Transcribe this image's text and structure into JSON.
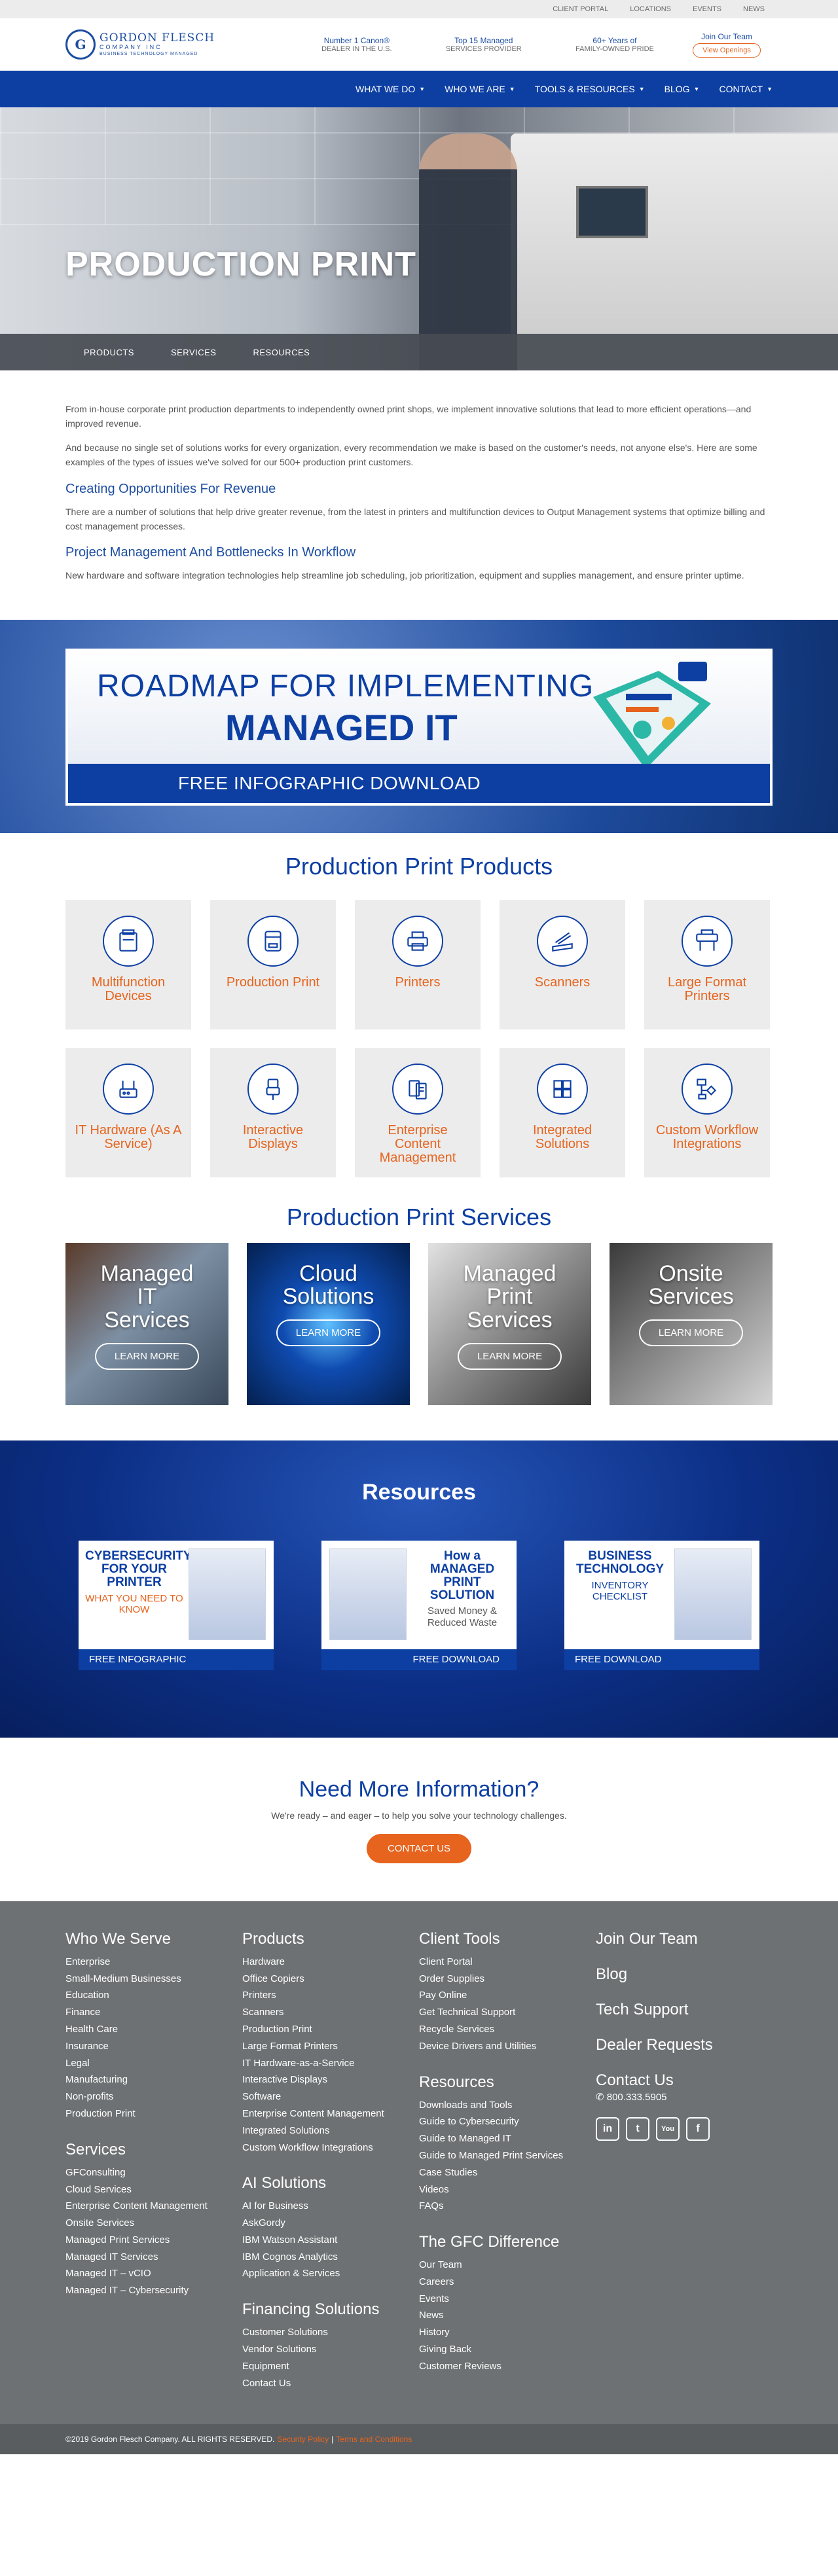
{
  "utility": {
    "links": [
      "CLIENT PORTAL",
      "LOCATIONS",
      "EVENTS",
      "NEWS"
    ]
  },
  "header": {
    "logo_name": "GORDON FLESCH",
    "logo_company": "COMPANY INC",
    "logo_tag": "BUSINESS TECHNOLOGY MANAGED",
    "stats": [
      {
        "top": "Number 1 Canon®",
        "bottom": "DEALER IN THE U.S."
      },
      {
        "top": "Top 15 Managed",
        "bottom": "SERVICES PROVIDER"
      },
      {
        "top": "60+ Years of",
        "bottom": "FAMILY-OWNED PRIDE"
      }
    ],
    "join_label": "Join Our Team",
    "join_button": "View Openings"
  },
  "nav": {
    "items": [
      "WHAT WE DO",
      "WHO WE ARE",
      "TOOLS & RESOURCES",
      "BLOG",
      "CONTACT"
    ]
  },
  "hero": {
    "title": "PRODUCTION PRINT",
    "subnav": [
      "PRODUCTS",
      "SERVICES",
      "RESOURCES"
    ]
  },
  "intro": {
    "p1": "From in-house corporate print production departments to independently owned print shops, we implement innovative solutions that lead to more efficient operations—and improved revenue.",
    "p2": "And because no single set of solutions works for every organization, every recommendation we make is based on the customer's needs, not anyone else's. Here are some examples of the types of issues we've solved for our 500+ production print customers.",
    "h1": "Creating Opportunities For Revenue",
    "p3": "There are a number of solutions that help drive greater revenue, from the latest in printers and multifunction devices to Output Management systems that optimize billing and cost management processes.",
    "h2": "Project Management And Bottlenecks In Workflow",
    "p4": "New hardware and software integration technologies help streamline job scheduling, job prioritization, equipment and supplies management, and ensure printer uptime."
  },
  "banner": {
    "line1": "ROADMAP FOR IMPLEMENTING",
    "line2": "MANAGED IT",
    "cta": "FREE INFOGRAPHIC DOWNLOAD"
  },
  "products": {
    "title": "Production Print Products",
    "items": [
      {
        "label": "Multifunction Devices",
        "icon": "mfp-icon"
      },
      {
        "label": "Production Print",
        "icon": "production-printer-icon"
      },
      {
        "label": "Printers",
        "icon": "printer-icon"
      },
      {
        "label": "Scanners",
        "icon": "scanner-icon"
      },
      {
        "label": "Large Format Printers",
        "icon": "large-format-printer-icon"
      },
      {
        "label": "IT Hardware (As A Service)",
        "icon": "router-icon"
      },
      {
        "label": "Interactive Displays",
        "icon": "usb-icon"
      },
      {
        "label": "Enterprise Content Management",
        "icon": "documents-icon"
      },
      {
        "label": "Integrated Solutions",
        "icon": "puzzle-icon"
      },
      {
        "label": "Custom Workflow Integrations",
        "icon": "workflow-icon"
      }
    ]
  },
  "services": {
    "title": "Production Print Services",
    "items": [
      {
        "title": "Managed IT Services",
        "button": "LEARN MORE"
      },
      {
        "title": "Cloud Solutions",
        "button": "LEARN MORE"
      },
      {
        "title": "Managed Print Services",
        "button": "LEARN MORE"
      },
      {
        "title": "Onsite Services",
        "button": "LEARN MORE"
      }
    ]
  },
  "resources": {
    "title": "Resources",
    "items": [
      {
        "big": "CYBERSECURITY FOR YOUR PRINTER",
        "small": "WHAT YOU NEED TO KNOW",
        "foot": "FREE INFOGRAPHIC"
      },
      {
        "big": "How a MANAGED PRINT SOLUTION",
        "small": "Saved Money & Reduced Waste",
        "foot": "FREE DOWNLOAD"
      },
      {
        "big": "BUSINESS TECHNOLOGY",
        "small": "INVENTORY CHECKLIST",
        "foot": "FREE DOWNLOAD"
      }
    ]
  },
  "needinfo": {
    "title": "Need More Information?",
    "text": "We're ready – and eager – to help you solve your technology challenges.",
    "button": "CONTACT US"
  },
  "footer": {
    "who_title": "Who We Serve",
    "who": [
      "Enterprise",
      "Small-Medium Businesses",
      "Education",
      "Finance",
      "Health Care",
      "Insurance",
      "Legal",
      "Manufacturing",
      "Non-profits",
      "Production Print"
    ],
    "services_title": "Services",
    "services": [
      "GFConsulting",
      "Cloud Services",
      "Enterprise Content Management",
      "Onsite Services",
      "Managed Print Services",
      "Managed IT Services",
      "Managed IT – vCIO",
      "Managed IT – Cybersecurity"
    ],
    "products_title": "Products",
    "products": [
      "Hardware",
      "Office Copiers",
      "Printers",
      "Scanners",
      "Production Print",
      "Large Format Printers",
      "IT Hardware-as-a-Service",
      "Interactive Displays",
      "Software",
      "Enterprise Content Management",
      "Integrated Solutions",
      "Custom Workflow Integrations"
    ],
    "ai_title": "AI Solutions",
    "ai": [
      "AI for Business",
      "AskGordy",
      "IBM Watson Assistant",
      "IBM Cognos Analytics",
      "Application & Services"
    ],
    "financing_title": "Financing Solutions",
    "financing": [
      "Customer Solutions",
      "Vendor Solutions",
      "Equipment",
      "Contact Us"
    ],
    "client_title": "Client Tools",
    "client": [
      "Client Portal",
      "Order Supplies",
      "Pay Online",
      "Get Technical Support",
      "Recycle Services",
      "Device Drivers and Utilities"
    ],
    "resources_title": "Resources",
    "resources": [
      "Downloads and Tools",
      "Guide to Cybersecurity",
      "Guide to Managed IT",
      "Guide to Managed Print Services",
      "Case Studies",
      "Videos",
      "FAQs"
    ],
    "gfc_title": "The GFC Difference",
    "gfc": [
      "Our Team",
      "Careers",
      "Events",
      "News",
      "History",
      "Giving Back",
      "Customer Reviews"
    ],
    "big_links": [
      "Join Our Team",
      "Blog",
      "Tech Support",
      "Dealer Requests"
    ],
    "contact_title": "Contact Us",
    "phone": "800.333.5905",
    "social": [
      "in",
      "t",
      "You",
      "f"
    ]
  },
  "copyright": {
    "text": "©2019 Gordon Flesch Company. ALL RIGHTS RESERVED.",
    "policy": "Security Policy",
    "sep": "|",
    "terms": "Terms and Conditions"
  },
  "colors": {
    "brand_blue": "#0d3fa3",
    "accent_orange": "#e6641e",
    "footer_gray": "#6e7173"
  }
}
